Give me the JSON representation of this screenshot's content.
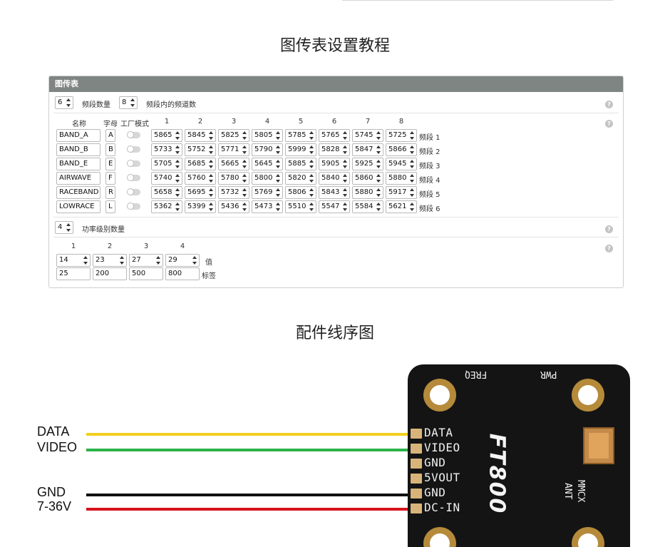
{
  "titles": {
    "settings": "图传表设置教程",
    "wiring": "配件线序图"
  },
  "panel": {
    "header": "图传表",
    "band_count": "6",
    "band_count_label": "频段数量",
    "channel_count": "8",
    "channel_count_label": "频段内的频道数",
    "help_glyph": "?",
    "table": {
      "col_name": "名称",
      "col_letter": "字母",
      "col_factory": "工厂模式",
      "channel_headers": [
        "1",
        "2",
        "3",
        "4",
        "5",
        "6",
        "7",
        "8"
      ],
      "bands": [
        {
          "name": "BAND_A",
          "letter": "A",
          "factory": false,
          "freqs": [
            "5865",
            "5845",
            "5825",
            "5805",
            "5785",
            "5765",
            "5745",
            "5725"
          ],
          "label": "频段 1"
        },
        {
          "name": "BAND_B",
          "letter": "B",
          "factory": false,
          "freqs": [
            "5733",
            "5752",
            "5771",
            "5790",
            "5999",
            "5828",
            "5847",
            "5866"
          ],
          "label": "频段 2"
        },
        {
          "name": "BAND_E",
          "letter": "E",
          "factory": false,
          "freqs": [
            "5705",
            "5685",
            "5665",
            "5645",
            "5885",
            "5905",
            "5925",
            "5945"
          ],
          "label": "频段 3"
        },
        {
          "name": "AIRWAVE",
          "letter": "F",
          "factory": false,
          "freqs": [
            "5740",
            "5760",
            "5780",
            "5800",
            "5820",
            "5840",
            "5860",
            "5880"
          ],
          "label": "频段 4"
        },
        {
          "name": "RACEBAND",
          "letter": "R",
          "factory": false,
          "freqs": [
            "5658",
            "5695",
            "5732",
            "5769",
            "5806",
            "5843",
            "5880",
            "5917"
          ],
          "label": "频段 5"
        },
        {
          "name": "LOWRACE",
          "letter": "L",
          "factory": false,
          "freqs": [
            "5362",
            "5399",
            "5436",
            "5473",
            "5510",
            "5547",
            "5584",
            "5621"
          ],
          "label": "频段 6"
        }
      ]
    },
    "power": {
      "count": "4",
      "count_label": "功率级别数量",
      "headers": [
        "1",
        "2",
        "3",
        "4"
      ],
      "values": [
        "14",
        "23",
        "27",
        "29"
      ],
      "values_label": "值",
      "labels": [
        "25",
        "200",
        "500",
        "800"
      ],
      "labels_label": "标签"
    }
  },
  "wiring": {
    "wires": [
      {
        "label": "DATA",
        "color": "#f2cf1d"
      },
      {
        "label": "VIDEO",
        "color": "#2db34a"
      },
      {
        "label": "GND",
        "color": "#111111"
      },
      {
        "label": "7-36V",
        "color": "#d8131b"
      }
    ],
    "board": {
      "pins": [
        "DATA",
        "VIDEO",
        "GND",
        "5VOUT",
        "GND",
        "DC-IN"
      ],
      "logo": "FT800",
      "freq_label": "FREQ",
      "pwr_label": "PWR",
      "ant_label_1": "MMCX",
      "ant_label_2": "ANT"
    }
  }
}
